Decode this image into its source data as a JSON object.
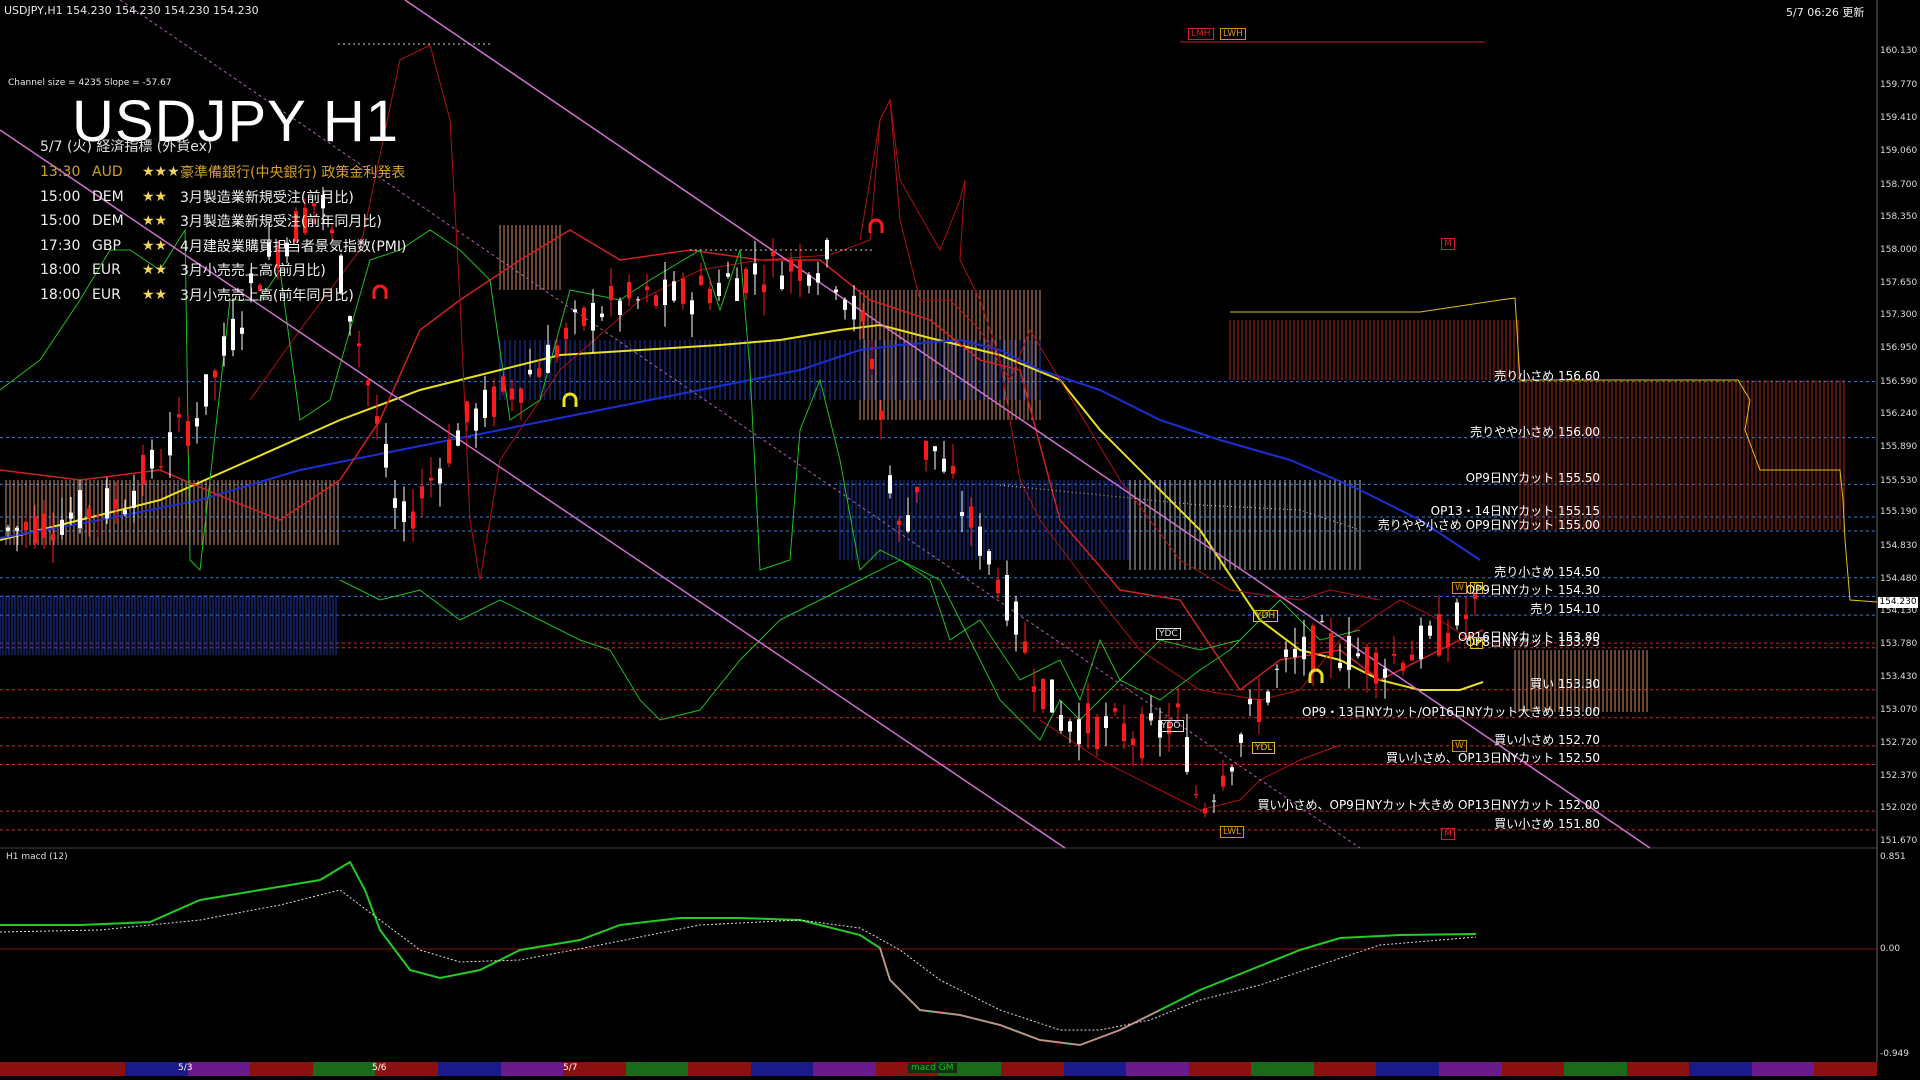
{
  "header": {
    "symbol_line": "USDJPY,H1  154.230 154.230 154.230 154.230",
    "update": "5/7 06:26 更新",
    "channel_info": "Channel size = 4235 Slope = -57.67"
  },
  "title": "USDJPY H1",
  "news": {
    "date_line": "5/7 (火) 経済指標 (外貨ex)",
    "rows": [
      {
        "time": "13:30",
        "currency": "AUD",
        "stars": "★★★",
        "event": "豪準備銀行(中央銀行)  政策金利発表",
        "color": "#d4a020"
      },
      {
        "time": "15:00",
        "currency": "DEM",
        "stars": "★★",
        "event": "3月製造業新規受注(前月比)",
        "color": "#f0f0f0"
      },
      {
        "time": "15:00",
        "currency": "DEM",
        "stars": "★★",
        "event": "3月製造業新規受注(前年同月比)",
        "color": "#f0f0f0"
      },
      {
        "time": "17:30",
        "currency": "GBP",
        "stars": "★★",
        "event": "4月建設業購買担当者景気指数(PMI)",
        "color": "#f0f0f0"
      },
      {
        "time": "18:00",
        "currency": "EUR",
        "stars": "★★",
        "event": "3月小売売上高(前月比)",
        "color": "#f0f0f0"
      },
      {
        "time": "18:00",
        "currency": "EUR",
        "stars": "★★",
        "event": "3月小売売上高(前年同月比)",
        "color": "#f0f0f0"
      }
    ]
  },
  "price_axis": {
    "ticks": [
      "160.130",
      "159.770",
      "159.410",
      "159.060",
      "158.700",
      "158.350",
      "158.000",
      "157.650",
      "157.300",
      "156.950",
      "156.590",
      "156.240",
      "155.890",
      "155.530",
      "155.190",
      "154.830",
      "154.480",
      "154.130",
      "153.780",
      "153.430",
      "153.070",
      "152.720",
      "152.370",
      "152.020",
      "151.670"
    ],
    "current": "154.230"
  },
  "levels": [
    {
      "label": "売り小さめ 156.60",
      "price": 156.6,
      "color": "#3a7bd5",
      "style": "dash"
    },
    {
      "label": "売りやや小さめ 156.00",
      "price": 156.0,
      "color": "#3a7bd5",
      "style": "dash"
    },
    {
      "label": "OP9日NYカット 155.50",
      "price": 155.5,
      "color": "#3a7bd5",
      "style": "dash"
    },
    {
      "label": "OP13・14日NYカット 155.15",
      "price": 155.15,
      "color": "#3a7bd5",
      "style": "dash"
    },
    {
      "label": "売りやや小さめ OP9日NYカット 155.00",
      "price": 155.0,
      "color": "#3a7bd5",
      "style": "dash"
    },
    {
      "label": "売り小さめ 154.50",
      "price": 154.5,
      "color": "#3a7bd5",
      "style": "dash"
    },
    {
      "label": "OP9日NYカット 154.30",
      "price": 154.3,
      "color": "#3a7bd5",
      "style": "dash"
    },
    {
      "label": "売り 154.10",
      "price": 154.1,
      "color": "#3a7bd5",
      "style": "dash"
    },
    {
      "label": "OP16日NYカット 153.80",
      "price": 153.8,
      "color": "#c03030",
      "style": "dash"
    },
    {
      "label": "OP8日NYカット 153.75",
      "price": 153.75,
      "color": "#c03030",
      "style": "dash"
    },
    {
      "label": "買い 153.30",
      "price": 153.3,
      "color": "#c03030",
      "style": "dash"
    },
    {
      "label": "OP9・13日NYカット/OP16日NYカット大きめ 153.00",
      "price": 153.0,
      "color": "#c03030",
      "style": "dash"
    },
    {
      "label": "買い小さめ 152.70",
      "price": 152.7,
      "color": "#c03030",
      "style": "dash"
    },
    {
      "label": "買い小さめ、OP13日NYカット 152.50",
      "price": 152.5,
      "color": "#c03030",
      "style": "dash"
    },
    {
      "label": "買い小さめ、OP9日NYカット大きめ OP13日NYカット 152.00",
      "price": 152.0,
      "color": "#c03030",
      "style": "dash"
    },
    {
      "label": "買い小さめ 151.80",
      "price": 151.8,
      "color": "#c03030",
      "style": "dash"
    }
  ],
  "markers": [
    {
      "text": "LMH",
      "color": "#d02020"
    },
    {
      "text": "LWH",
      "color": "#d09020"
    },
    {
      "text": "YDH",
      "color": "#e0c020"
    },
    {
      "text": "YDC",
      "color": "#e0e0e0"
    },
    {
      "text": "YDO",
      "color": "#e0e0e0"
    },
    {
      "text": "YDL",
      "color": "#e0c020"
    },
    {
      "text": "LWL",
      "color": "#d09020"
    },
    {
      "text": "W",
      "color": "#d09020"
    },
    {
      "text": "D",
      "color": "#e0c020"
    },
    {
      "text": "D",
      "color": "#e0c020"
    },
    {
      "text": "W",
      "color": "#d09020"
    },
    {
      "text": "M",
      "color": "#d02020"
    },
    {
      "text": "M",
      "color": "#d02020"
    }
  ],
  "macd": {
    "label": "H1  macd (12)",
    "ticks": [
      "0.851",
      "0.00",
      "-0.949"
    ]
  },
  "dates": [
    "5/3",
    "5/6",
    "5/7"
  ],
  "bottom_tag": "macd GM",
  "colors": {
    "bull": "#ffffff",
    "bear": "#ff1a1a",
    "ma_yellow": "#e8e020",
    "ma_blue": "#1a2fd0",
    "green": "#1fbf1f",
    "pink": "#d070d0",
    "cloud_orange": "#e8a070",
    "cloud_blue": "#2040c0",
    "cloud_red": "#c03020"
  }
}
